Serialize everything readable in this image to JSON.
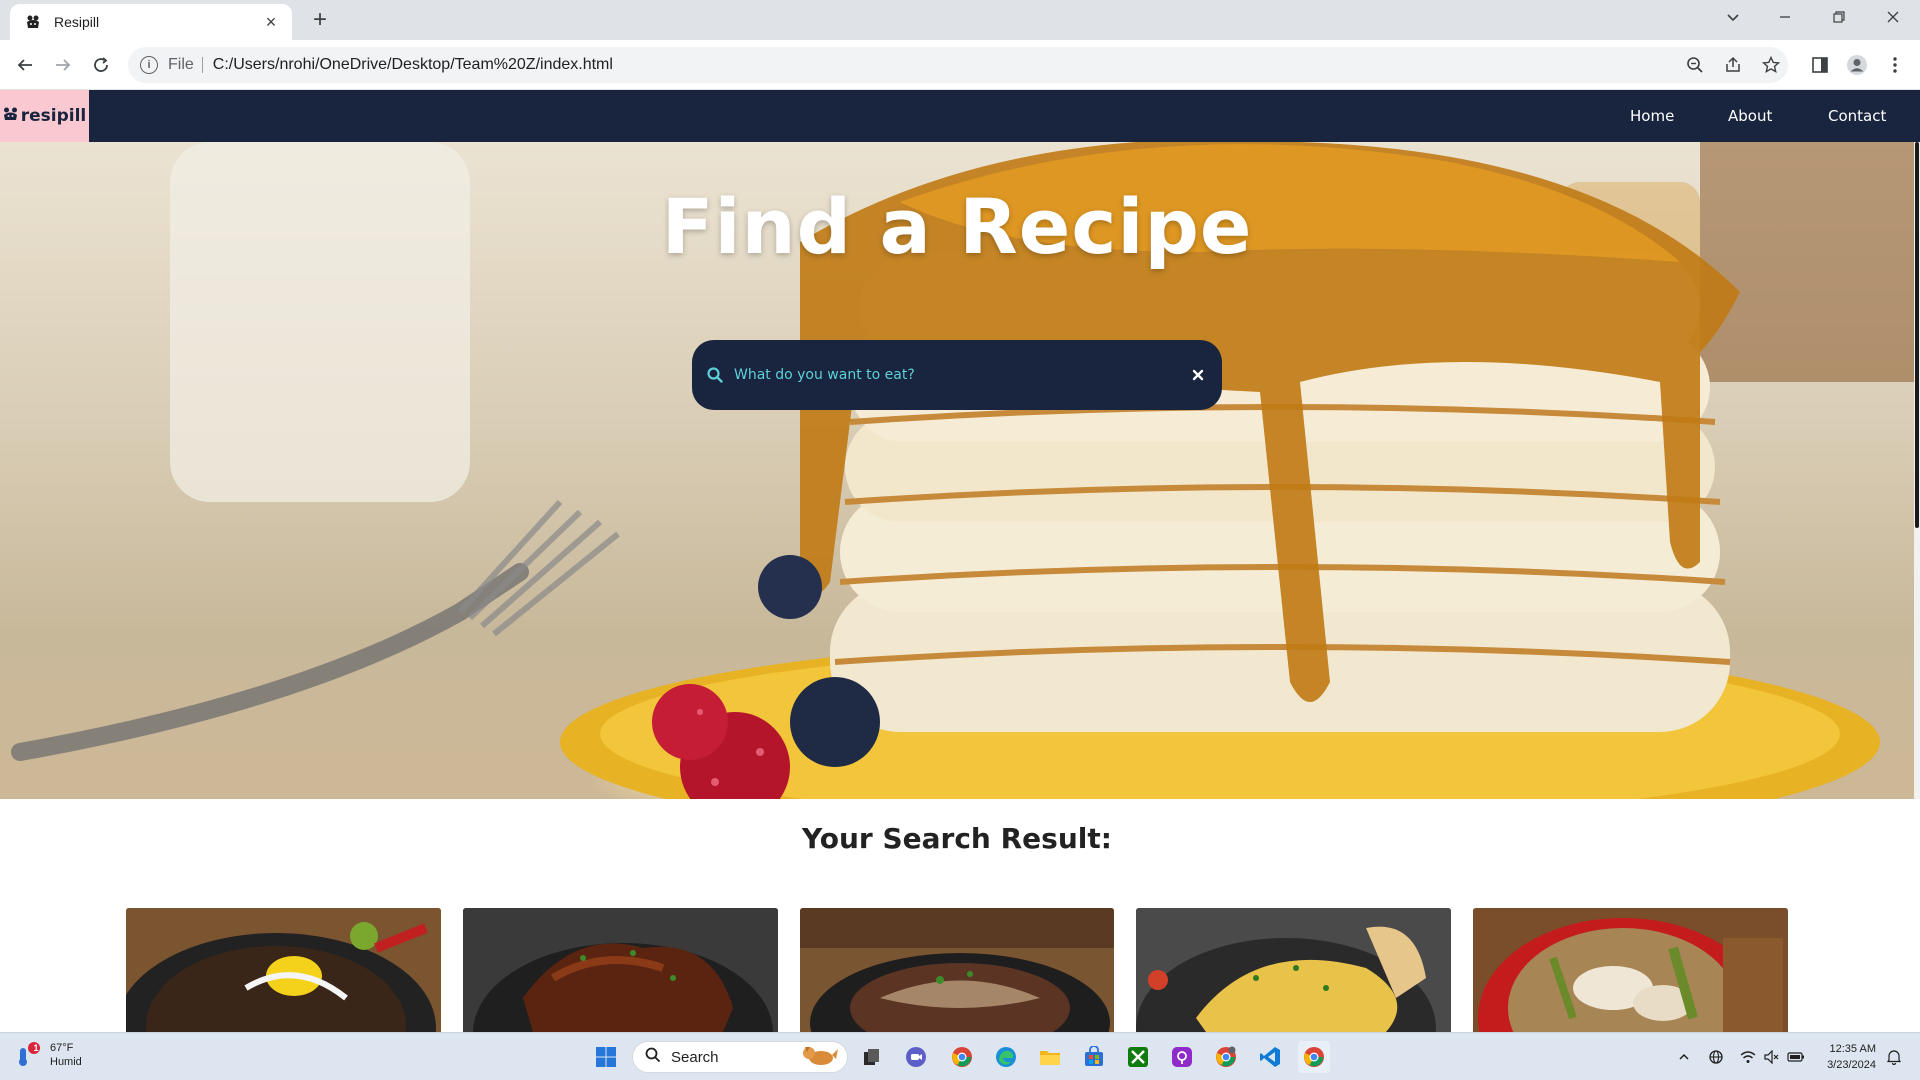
{
  "browser": {
    "tab_title": "Resipill",
    "tab_close": "×",
    "new_tab": "+",
    "address_chip": "File",
    "url": "C:/Users/nrohi/OneDrive/Desktop/Team%20Z/index.html"
  },
  "site": {
    "logo_text": "resipill",
    "nav": [
      "Home",
      "About",
      "Contact"
    ],
    "hero_title": "Find a Recipe",
    "search_placeholder": "What do you want to eat?",
    "results_heading": "Your Search Result:",
    "cards": [
      {
        "icon": "sizzling-sisig-photo"
      },
      {
        "icon": "grilled-chicken-photo"
      },
      {
        "icon": "steak-with-gravy-photo"
      },
      {
        "icon": "omelette-photo"
      },
      {
        "icon": "soup-bowl-photo"
      }
    ]
  },
  "taskbar": {
    "weather_temp": "67°F",
    "weather_desc": "Humid",
    "weather_badge": "1",
    "search_label": "Search",
    "time": "12:35 AM",
    "date": "3/23/2024"
  },
  "colors": {
    "navy": "#19243f",
    "logo_pink": "#f9c8d0",
    "search_text": "#5ed0d8"
  }
}
